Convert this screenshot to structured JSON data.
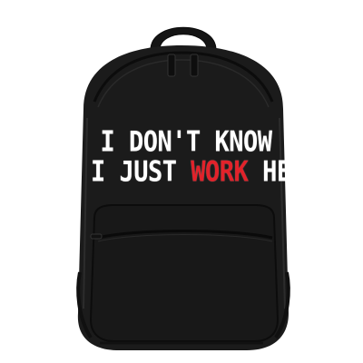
{
  "image": {
    "subject": "backpack-product-photo",
    "background_color": "#ffffff",
    "bag_color": "#1a1a1a",
    "text_color": "#ffffff",
    "accent_color": "#e2222a"
  },
  "print": {
    "line1": "I DON'T KNOW",
    "line2_part1": "I JUST ",
    "line2_accent": "WORK",
    "line2_part2": " HERE"
  }
}
